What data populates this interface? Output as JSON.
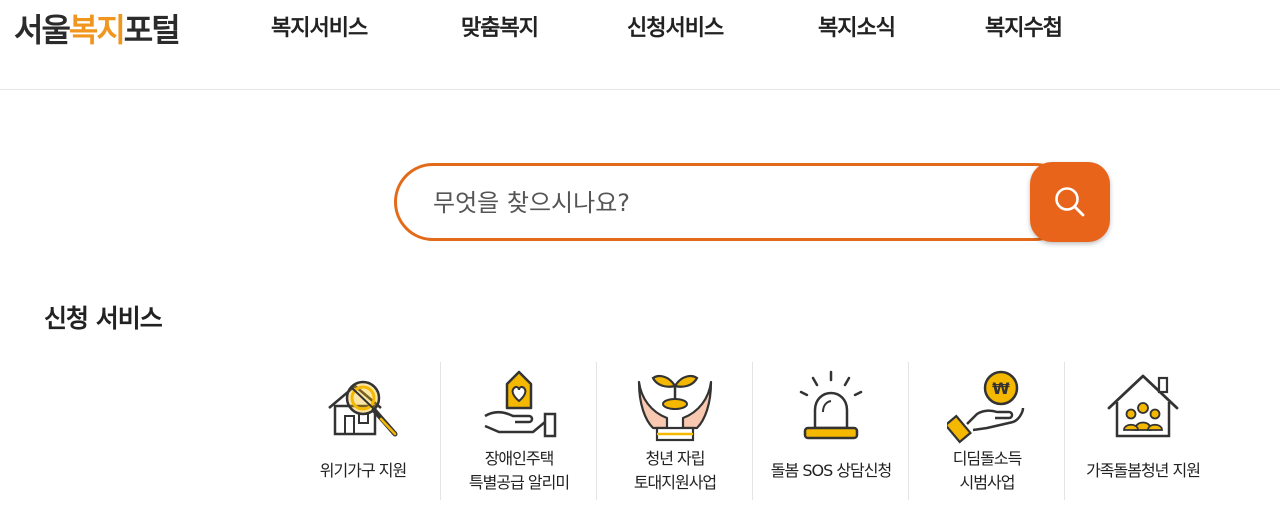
{
  "header": {
    "logo_part1": "서울",
    "logo_part2": "복지",
    "logo_part3": "포털",
    "nav": [
      "복지서비스",
      "맞춤복지",
      "신청서비스",
      "복지소식",
      "복지수첩"
    ]
  },
  "search": {
    "placeholder": "무엇을 찾으시나요?",
    "value": ""
  },
  "apply_section": {
    "title": "신청 서비스",
    "items": [
      {
        "line1": "위기가구 지원",
        "line2": "",
        "icon": "magnifier-house-icon"
      },
      {
        "line1": "장애인주택",
        "line2": "특별공급 알리미",
        "icon": "hand-heart-house-icon"
      },
      {
        "line1": "청년 자립",
        "line2": "토대지원사업",
        "icon": "hands-sprout-icon"
      },
      {
        "line1": "돌봄 SOS 상담신청",
        "line2": "",
        "icon": "siren-icon"
      },
      {
        "line1": "디딤돌소득",
        "line2": "시범사업",
        "icon": "hand-coin-icon"
      },
      {
        "line1": "가족돌봄청년 지원",
        "line2": "",
        "icon": "family-house-icon"
      }
    ]
  },
  "colors": {
    "accent": "#e8641a",
    "logo_accent": "#f0961e",
    "icon_yellow": "#f5b800"
  }
}
